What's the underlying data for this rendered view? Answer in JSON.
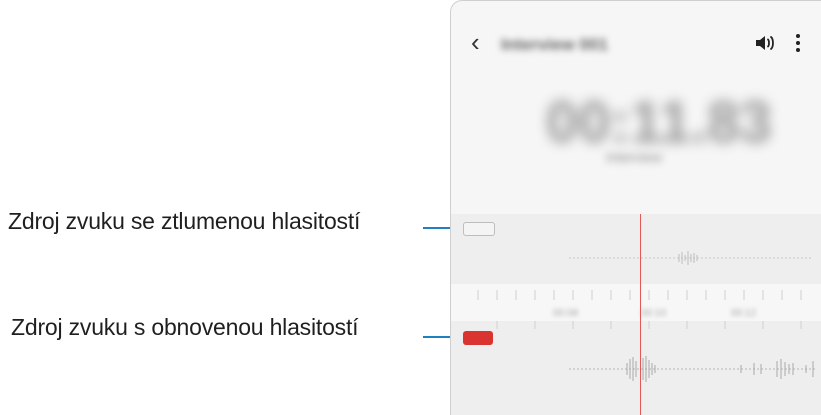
{
  "callouts": {
    "muted_source": "Zdroj zvuku se ztlumenou hlasitostí",
    "restored_source": "Zdroj zvuku s obnovenou hlasitostí"
  },
  "app": {
    "back_icon": "chevron-left-icon",
    "title": "Interview 001",
    "volume_icon": "speaker-icon",
    "more_icon": "more-vertical-icon",
    "timer": "00:11.83",
    "subtitle": "Interview"
  },
  "timeline": {
    "ruler_labels": [
      "00:08",
      "00:10",
      "00:12"
    ],
    "playhead_color": "#e25a55"
  },
  "tracks": [
    {
      "name": "muted",
      "state": "muted"
    },
    {
      "name": "restored",
      "state": "active",
      "accent": "#d9342f"
    }
  ]
}
